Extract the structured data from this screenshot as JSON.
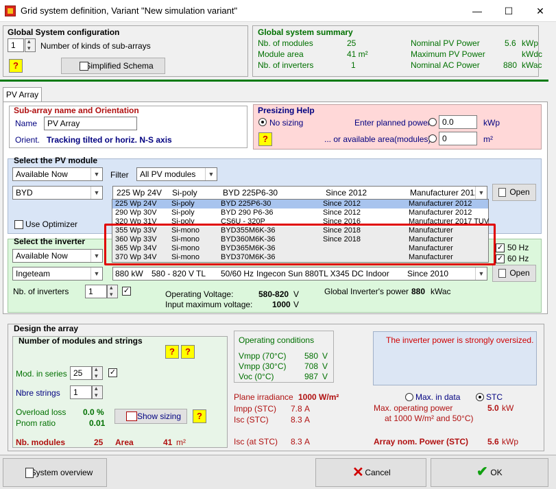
{
  "window": {
    "title": "Grid system definition, Variant  \"New simulation variant\"",
    "minimize": "—",
    "maximize": "☐",
    "close": "✕"
  },
  "global_config": {
    "title": "Global System configuration",
    "kinds_value": "1",
    "kinds_label": "Number of kinds of sub-arrays",
    "help_label": "?",
    "schema_button": "Simplified Schema"
  },
  "summary": {
    "title": "Global system summary",
    "nb_modules_label": "Nb. of modules",
    "nb_modules_value": "25",
    "module_area_label": "Module area",
    "module_area_value": "41 m²",
    "nb_inverters_label": "Nb. of inverters",
    "nb_inverters_value": "1",
    "nominal_pv_label": "Nominal PV Power",
    "nominal_pv_value": "5.6",
    "nominal_pv_unit": "kWp",
    "max_pv_label": "Maximum PV Power",
    "max_pv_value": "",
    "max_pv_unit": "kWdc",
    "nominal_ac_label": "Nominal AC Power",
    "nominal_ac_value": "880",
    "nominal_ac_unit": "kWac"
  },
  "tab": {
    "label": "PV Array"
  },
  "subarray": {
    "title": "Sub-array name and Orientation",
    "name_label": "Name",
    "name_value": "PV Array",
    "orient_label": "Orient.",
    "orient_value": "Tracking tilted or horiz. N-S axis"
  },
  "presizing": {
    "title": "Presizing Help",
    "no_sizing": "No sizing",
    "planned_power_label": "Enter planned power",
    "planned_power_value": "0.0",
    "planned_power_unit": "kWp",
    "area_label": "... or available area(modules)",
    "area_value": "0",
    "area_unit": "m²",
    "help_label": "?"
  },
  "pv_module": {
    "title": "Select the PV module",
    "availability": "Available Now",
    "filter_label": "Filter",
    "filter_value": "All PV modules",
    "manufacturer": "BYD",
    "selected": {
      "power": "225 Wp 24V",
      "tech": "Si-poly",
      "model": "BYD 225P6-30",
      "since": "Since 2012",
      "maker": "Manufacturer 2012"
    },
    "open_label": "Open",
    "optimizer_label": "Use Optimizer",
    "list": [
      {
        "power": "225 Wp 24V",
        "tech": "Si-poly",
        "model": "BYD 225P6-30",
        "since": "Since 2012",
        "maker": "Manufacturer 2012"
      },
      {
        "power": "290 Wp 30V",
        "tech": "Si-poly",
        "model": "BYD 290 P6-36",
        "since": "Since 2012",
        "maker": "Manufacturer 2012"
      },
      {
        "power": "320 Wp 31V",
        "tech": "Si-poly",
        "model": "CS6U - 320P",
        "since": "Since 2016",
        "maker": "Manufacturer 2017 TUV"
      },
      {
        "power": "355 Wp 33V",
        "tech": "Si-mono",
        "model": "BYD355M6K-36",
        "since": "Since 2018",
        "maker": "Manufacturer"
      },
      {
        "power": "360 Wp 33V",
        "tech": "Si-mono",
        "model": "BYD360M6K-36",
        "since": "Since 2018",
        "maker": "Manufacturer"
      },
      {
        "power": "365 Wp 34V",
        "tech": "Si-mono",
        "model": "BYD365M6K-36",
        "since": "",
        "maker": "Manufacturer"
      },
      {
        "power": "370 Wp 34V",
        "tech": "Si-mono",
        "model": "BYD370M6K-36",
        "since": "",
        "maker": "Manufacturer"
      }
    ]
  },
  "inverter": {
    "title": "Select the inverter",
    "availability": "Available Now",
    "hz50": "50 Hz",
    "hz60": "60 Hz",
    "manufacturer": "Ingeteam",
    "selected": {
      "power": "880 kW",
      "voltage": "580 - 820 V",
      "type": "TL",
      "freq": "50/60 Hz",
      "model": "Ingecon Sun 880TL X345 DC Indoor",
      "since": "Since 2010"
    },
    "open_label": "Open",
    "nb_label": "Nb. of inverters",
    "nb_value": "1",
    "op_voltage_label": "Operating Voltage:",
    "op_voltage_value": "580-820",
    "op_voltage_unit": "V",
    "input_max_label": "Input maximum voltage:",
    "input_max_value": "1000",
    "input_max_unit": "V",
    "global_power_label": "Global Inverter's power",
    "global_power_value": "880",
    "global_power_unit": "kWac"
  },
  "design": {
    "title": "Design the array",
    "strings_title": "Number of modules and strings",
    "help1": "?",
    "help2": "?",
    "help3": "?",
    "mod_series_label": "Mod. in series",
    "mod_series_value": "25",
    "nbre_strings_label": "Nbre strings",
    "nbre_strings_value": "1",
    "overload_label": "Overload loss",
    "overload_value": "0.0 %",
    "pnom_label": "Pnom ratio",
    "pnom_value": "0.01",
    "show_sizing": "Show sizing",
    "nb_modules_label": "Nb. modules",
    "nb_modules_value": "25",
    "area_label": "Area",
    "area_value": "41",
    "area_unit": "m²",
    "op_cond_title": "Operating conditions",
    "vmpp70_label": "Vmpp (70°C)",
    "vmpp70_value": "580",
    "vmpp30_label": "Vmpp (30°C)",
    "vmpp30_value": "708",
    "voc0_label": "Voc  (0°C)",
    "voc0_value": "987",
    "volt_unit": "V",
    "warning": "The inverter power is strongly oversized.",
    "plane_irr_label": "Plane irradiance",
    "plane_irr_value": "1000 W/m²",
    "impp_label": "Impp (STC)",
    "impp_value": "7.8",
    "isc_label": "Isc  (STC)",
    "isc_value": "8.3",
    "isc_at_label": "Isc (at STC)",
    "isc_at_value": "8.3",
    "amp_unit": "A",
    "max_in_data": "Max. in data",
    "stc": "STC",
    "max_op_power_label": "Max. operating power",
    "max_op_power_sub": "at 1000 W/m² and 50°C)",
    "max_op_power_value": "5.0",
    "max_op_power_unit": "kW",
    "array_nom_label": "Array nom. Power (STC)",
    "array_nom_value": "5.6",
    "array_nom_unit": "kWp"
  },
  "footer": {
    "overview": "System overview",
    "cancel": "Cancel",
    "ok": "OK"
  },
  "colors": {
    "green_band": "#007a10",
    "highlight_box": "#e00000",
    "pink_panel": "#ffd8d8",
    "blue_panel": "#d9e5f6",
    "green_panel": "#dcf7dc"
  }
}
